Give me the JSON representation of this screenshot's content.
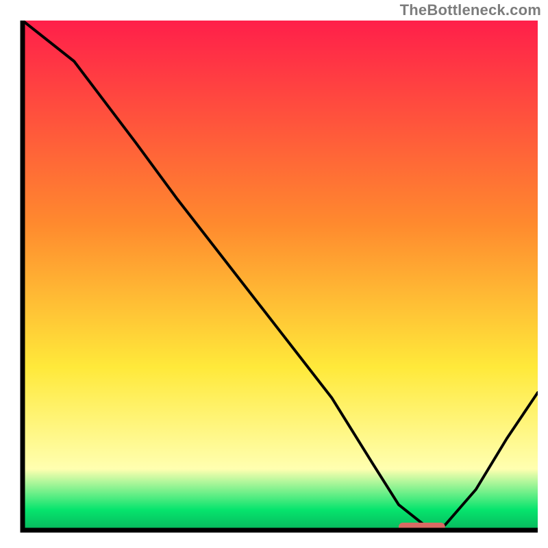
{
  "attribution": "TheBottleneck.com",
  "colors": {
    "axis": "#000000",
    "curve": "#000000",
    "marker_fill": "#d86a63",
    "gradient_top": "#ff1f4a",
    "gradient_mid1": "#ff8a2e",
    "gradient_mid2": "#ffe93a",
    "gradient_low": "#ffffb0",
    "gradient_green": "#06e46d",
    "gradient_bottom": "#07b85d"
  },
  "chart_data": {
    "type": "line",
    "title": "",
    "xlabel": "",
    "ylabel": "",
    "xlim": [
      0,
      100
    ],
    "ylim": [
      0,
      100
    ],
    "grid": false,
    "x": [
      0,
      10,
      22,
      30,
      40,
      50,
      60,
      68,
      73,
      78,
      82,
      88,
      94,
      100
    ],
    "values": [
      100,
      92,
      76,
      65,
      52,
      39,
      26,
      13,
      5,
      1,
      1,
      8,
      18,
      27
    ],
    "valley": {
      "x_start": 73,
      "x_end": 82,
      "y": 1
    }
  }
}
